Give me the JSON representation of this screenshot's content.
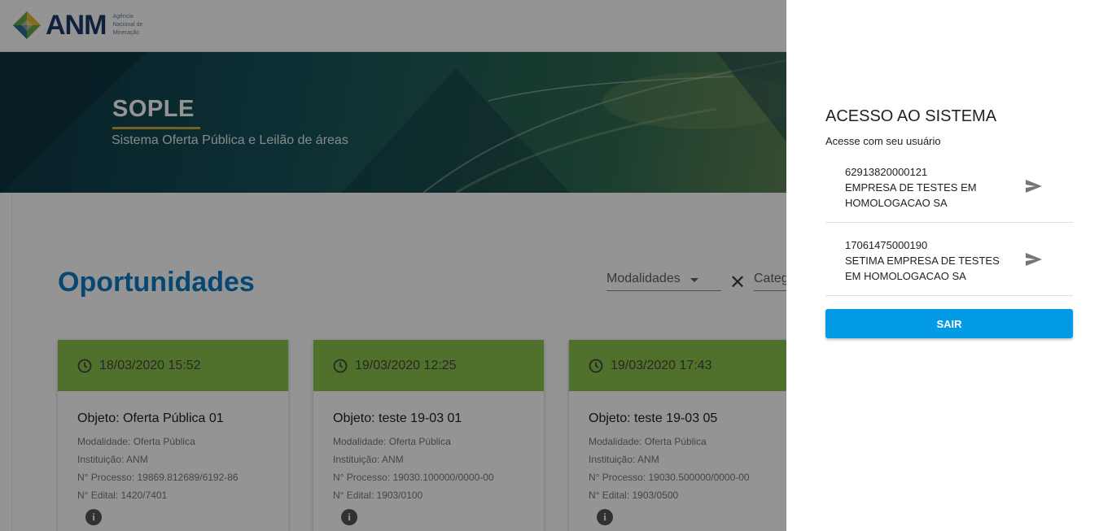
{
  "header": {
    "logo_text": "ANM",
    "logo_subtitle": "Agência Nacional de Mineração"
  },
  "banner": {
    "title": "SOPLE",
    "subtitle": "Sistema Oferta Pública e Leilão de áreas"
  },
  "main": {
    "heading": "Oportunidades",
    "filters": {
      "modalidades": "Modalidades",
      "categoria": "Categ"
    },
    "cards": [
      {
        "date": "18/03/2020 15:52",
        "title": "Objeto: Oferta Pública 01",
        "modalidade": "Modalidade: Oferta Pública",
        "instituicao": "Instituição: ANM",
        "processo": "N° Processo: 19869.812689/6192-86",
        "edital": "N° Edital: 1420/7401"
      },
      {
        "date": "19/03/2020 12:25",
        "title": "Objeto: teste 19-03 01",
        "modalidade": "Modalidade: Oferta Pública",
        "instituicao": "Instituição: ANM",
        "processo": "N° Processo: 19030.100000/0000-00",
        "edital": "N° Edital: 1903/0100"
      },
      {
        "date": "19/03/2020 17:43",
        "title": "Objeto: teste 19-03 05",
        "modalidade": "Modalidade: Oferta Pública",
        "instituicao": "Instituição: ANM",
        "processo": "N° Processo: 19030.500000/0000-00",
        "edital": "N° Edital: 1903/0500"
      }
    ]
  },
  "drawer": {
    "title": "ACESSO AO SISTEMA",
    "subtitle": "Acesse com seu usuário",
    "accounts": [
      {
        "cnpj": "62913820000121",
        "name": "EMPRESA DE TESTES EM HOMOLOGACAO SA"
      },
      {
        "cnpj": "17061475000190",
        "name": "SETIMA EMPRESA DE TESTES EM HOMOLOGACAO SA"
      }
    ],
    "logout_label": "SAIR"
  },
  "colors": {
    "card_header": "#8bc34a",
    "heading_blue": "#0d7bc4",
    "button_blue": "#039be5",
    "overlay": "rgba(0,0,0,0.42)"
  },
  "icons": {
    "clock": "clock-icon",
    "info": "info-icon",
    "send": "send-icon",
    "close": "close-icon",
    "dropdown": "chevron-down-icon"
  }
}
